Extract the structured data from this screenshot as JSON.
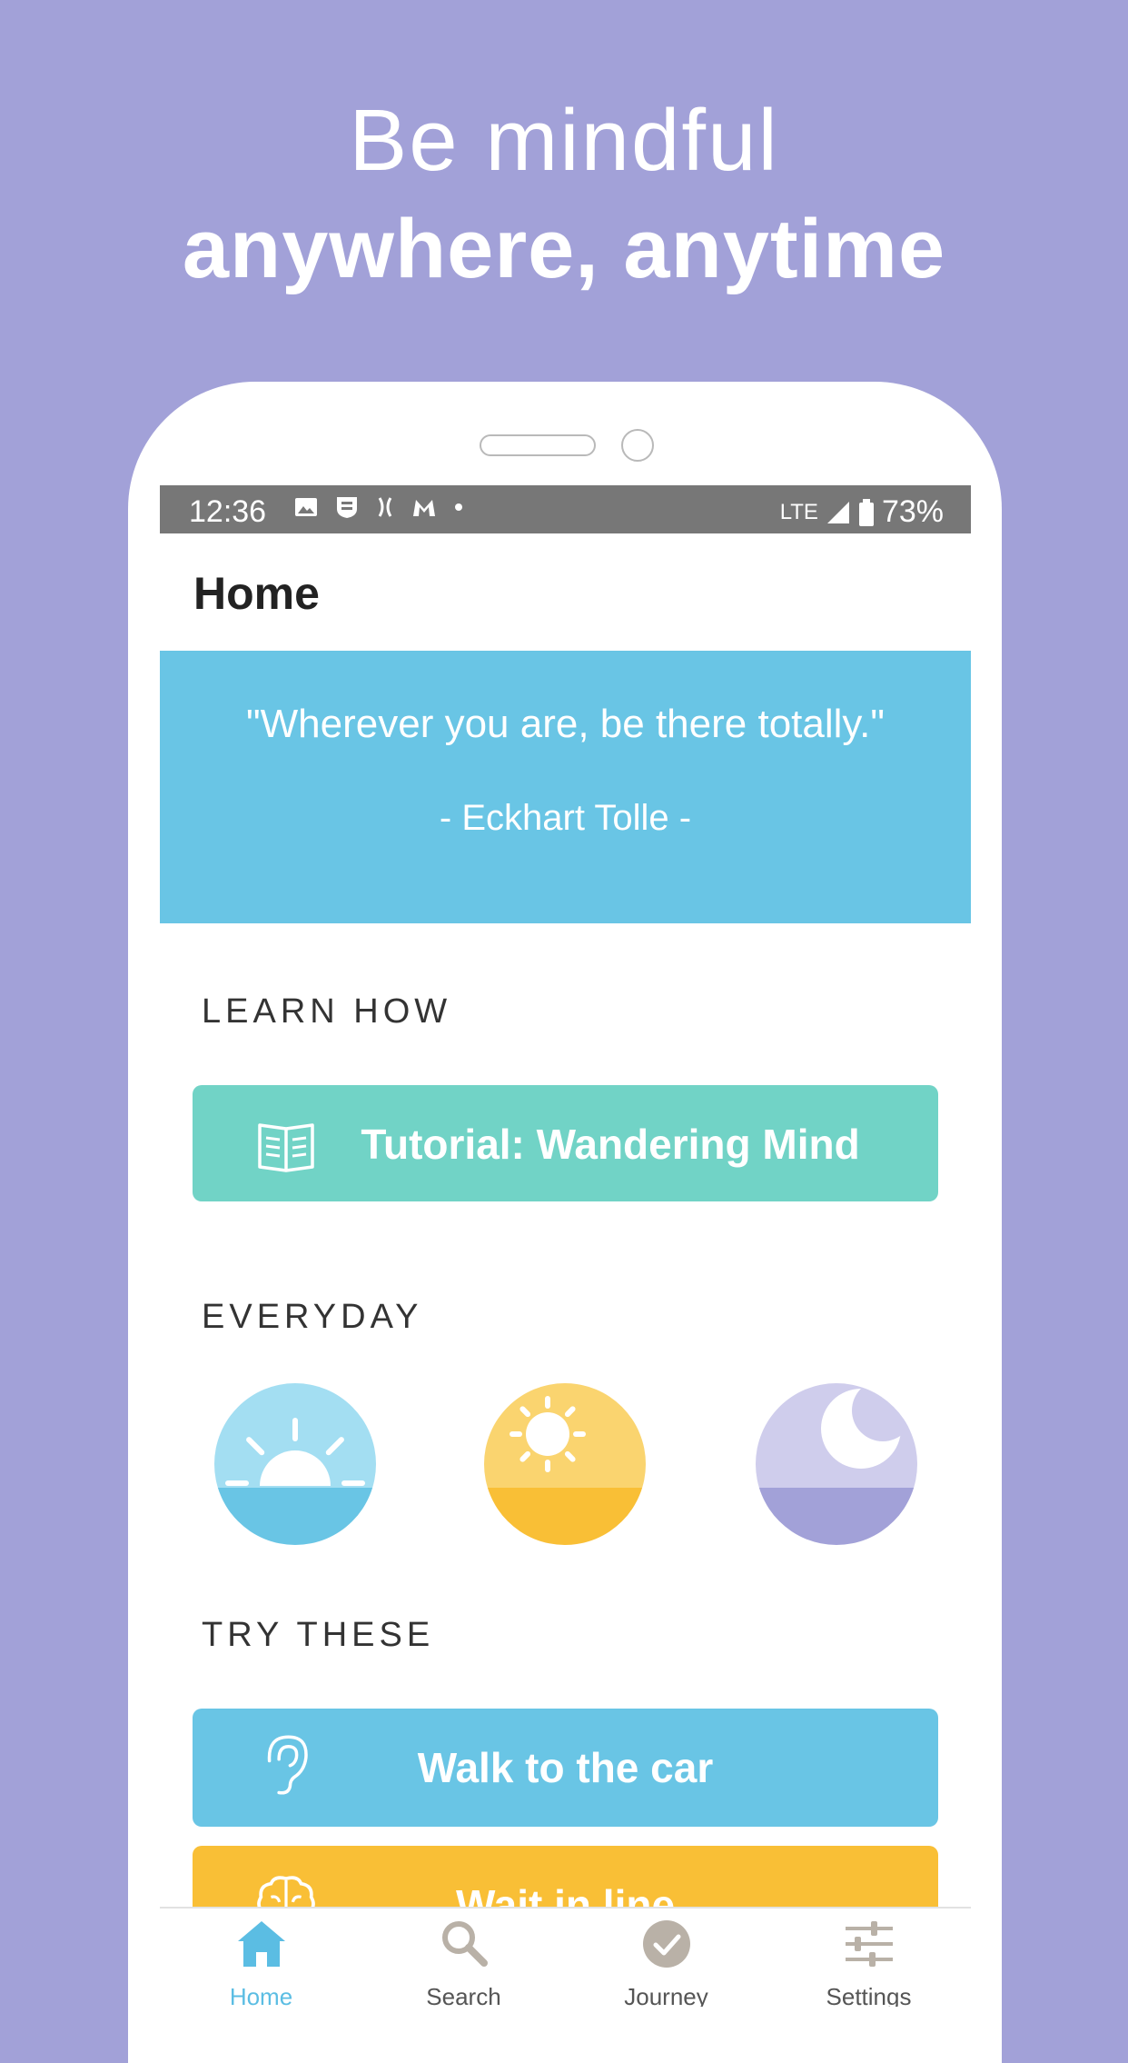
{
  "promo": {
    "line1": "Be mindful",
    "line2": "anywhere, anytime"
  },
  "status_bar": {
    "time": "12:36",
    "network": "LTE",
    "battery": "73%"
  },
  "app": {
    "title": "Home"
  },
  "quote": {
    "text": "\"Wherever you are, be there totally.\"",
    "author": "- Eckhart Tolle -"
  },
  "sections": {
    "learn_how": "LEARN HOW",
    "everyday": "EVERYDAY",
    "try_these": "TRY THESE"
  },
  "buttons": {
    "tutorial": "Tutorial: Wandering Mind",
    "walk": "Walk to the car",
    "wait": "Wait in line"
  },
  "everyday_icons": [
    "sunrise-icon",
    "sun-icon",
    "moon-icon"
  ],
  "tabs": [
    {
      "label": "Home",
      "icon": "home-icon",
      "active": true
    },
    {
      "label": "Search",
      "icon": "search-icon",
      "active": false
    },
    {
      "label": "Journey",
      "icon": "checkmark-icon",
      "active": false
    },
    {
      "label": "Settings",
      "icon": "sliders-icon",
      "active": false
    }
  ],
  "colors": {
    "background": "#a2a1d8",
    "quote_bg": "#69c5e5",
    "tutorial_bg": "#71d3c6",
    "walk_bg": "#69c5e5",
    "wait_bg": "#f9bf36",
    "active_tab": "#5bbde3"
  }
}
